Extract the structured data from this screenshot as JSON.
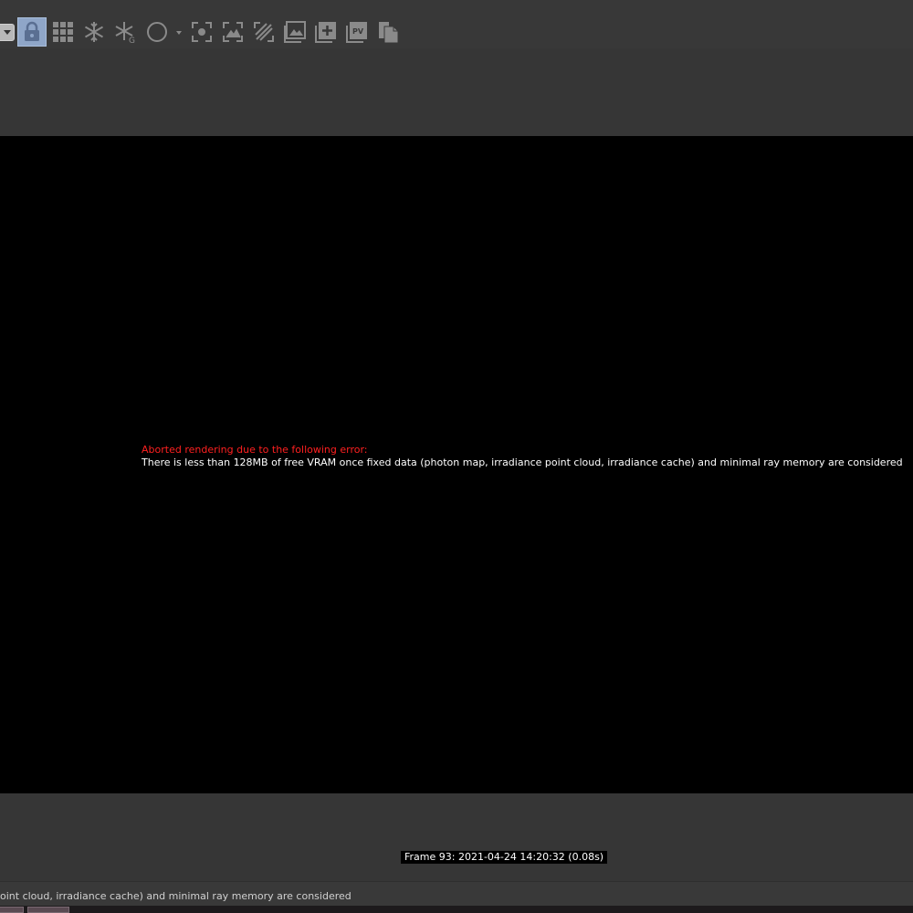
{
  "toolbar": {
    "buttons": [
      {
        "name": "lock-icon",
        "active": true
      },
      {
        "name": "grid-icon"
      },
      {
        "name": "snowflake-icon"
      },
      {
        "name": "snowflake-g-icon"
      },
      {
        "name": "circle-icon"
      },
      {
        "name": "focus-picker-icon"
      },
      {
        "name": "region-render-icon"
      },
      {
        "name": "film-region-icon"
      },
      {
        "name": "background-image-icon"
      },
      {
        "name": "add-image-icon"
      },
      {
        "name": "pv-icon",
        "label": "PV"
      },
      {
        "name": "copy-icon"
      }
    ]
  },
  "viewport": {
    "error_title": "Aborted rendering due to the following error:",
    "error_message": "There is less than 128MB of free VRAM once fixed data (photon map, irradiance point cloud, irradiance cache) and minimal ray memory are considered"
  },
  "frame_info": "Frame 93:  2021-04-24  14:20:32  (0.08s)",
  "status_bar": {
    "text": "oint cloud, irradiance cache) and minimal ray memory are considered"
  },
  "colors": {
    "error_red": "#ff2020",
    "active_button": "#8fa6c8",
    "icon_gray": "#8a8a8a"
  }
}
